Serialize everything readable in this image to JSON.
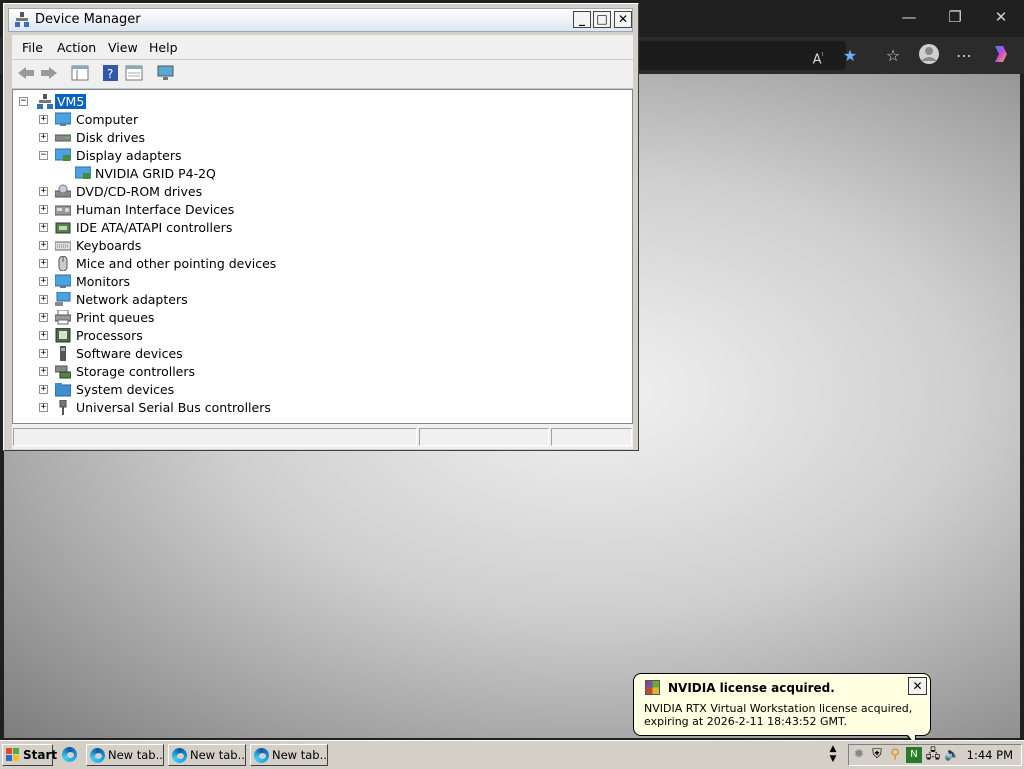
{
  "browser": {
    "caption": {
      "minimize": "—",
      "restore": "❐",
      "close": "✕"
    },
    "toolbar_icons": [
      "read-aloud-icon",
      "favorite-star-icon",
      "favorites-icon",
      "profile-icon",
      "more-icon",
      "copilot-icon"
    ]
  },
  "device_manager": {
    "title": "Device Manager",
    "menu": [
      "File",
      "Action",
      "View",
      "Help"
    ],
    "tree": {
      "root": "VM5",
      "nodes": [
        {
          "label": "Computer",
          "expanded": false,
          "icon": "computer-icon"
        },
        {
          "label": "Disk drives",
          "expanded": false,
          "icon": "disk-drive-icon"
        },
        {
          "label": "Display adapters",
          "expanded": true,
          "icon": "display-adapter-icon",
          "children": [
            "NVIDIA GRID P4-2Q"
          ]
        },
        {
          "label": "DVD/CD-ROM drives",
          "expanded": false,
          "icon": "dvd-drive-icon"
        },
        {
          "label": "Human Interface Devices",
          "expanded": false,
          "icon": "hid-icon"
        },
        {
          "label": "IDE ATA/ATAPI controllers",
          "expanded": false,
          "icon": "ide-controller-icon"
        },
        {
          "label": "Keyboards",
          "expanded": false,
          "icon": "keyboard-icon"
        },
        {
          "label": "Mice and other pointing devices",
          "expanded": false,
          "icon": "mouse-icon"
        },
        {
          "label": "Monitors",
          "expanded": false,
          "icon": "monitor-icon"
        },
        {
          "label": "Network adapters",
          "expanded": false,
          "icon": "network-adapter-icon"
        },
        {
          "label": "Print queues",
          "expanded": false,
          "icon": "printer-icon"
        },
        {
          "label": "Processors",
          "expanded": false,
          "icon": "processor-icon"
        },
        {
          "label": "Software devices",
          "expanded": false,
          "icon": "software-device-icon"
        },
        {
          "label": "Storage controllers",
          "expanded": false,
          "icon": "storage-controller-icon"
        },
        {
          "label": "System devices",
          "expanded": false,
          "icon": "system-devices-icon"
        },
        {
          "label": "Universal Serial Bus controllers",
          "expanded": false,
          "icon": "usb-icon"
        }
      ]
    }
  },
  "notification": {
    "title": "NVIDIA license acquired.",
    "message": "NVIDIA RTX Virtual Workstation license acquired, expiring at 2026-2-11 18:43:52 GMT."
  },
  "taskbar": {
    "start_label": "Start",
    "tasks": [
      "New tab...",
      "New tab...",
      "New tab..."
    ],
    "clock": "1:44 PM"
  },
  "colors": {
    "selection": "#0a63c4",
    "balloon": "#ffffe1",
    "taskbar": "#d4d0c8"
  }
}
